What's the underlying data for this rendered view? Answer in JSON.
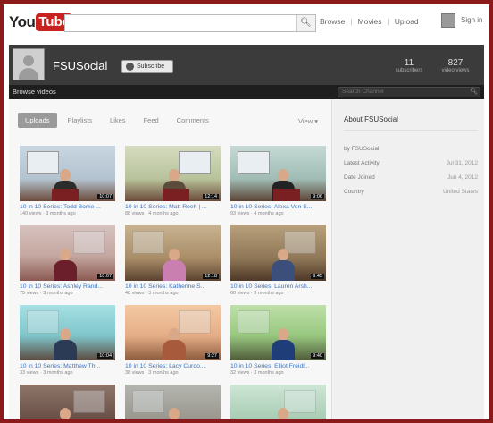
{
  "masthead": {
    "logo_you": "You",
    "logo_tube": "Tube",
    "search_placeholder": "",
    "nav": [
      "Browse",
      "Movies",
      "Upload"
    ],
    "signin": "Sign in"
  },
  "channel": {
    "name": "FSUSocial",
    "subscribe_label": "Subscribe",
    "stats": [
      {
        "value": "11",
        "label": "subscribers"
      },
      {
        "value": "827",
        "label": "video views"
      }
    ]
  },
  "channel_nav": {
    "browse_tab": "Browse videos",
    "search_placeholder": "Search Channel"
  },
  "tabs": [
    "Uploads",
    "Playlists",
    "Likes",
    "Feed",
    "Comments"
  ],
  "active_tab": "Uploads",
  "view_menu": "View ▾",
  "videos": [
    {
      "title": "10 in 10 Series: Todd Borke ...",
      "meta": "140 views · 3 months ago",
      "duration": "10:07",
      "scene": "room-blue"
    },
    {
      "title": "10 in 10 Series: Matt Reeh | ...",
      "meta": "88 views · 4 months ago",
      "duration": "12:14",
      "scene": "room-green"
    },
    {
      "title": "10 in 10 Series: Alexa Von S...",
      "meta": "93 views · 4 months ago",
      "duration": "9:06",
      "scene": "room-teal"
    },
    {
      "title": "10 in 10 Series: Ashley Rand...",
      "meta": "75 views · 3 months ago",
      "duration": "10:07",
      "scene": "room-pink"
    },
    {
      "title": "10 in 10 Series: Katherine S...",
      "meta": "48 views · 3 months ago",
      "duration": "12:18",
      "scene": "room-warm"
    },
    {
      "title": "10 in 10 Series: Lauren Arsh...",
      "meta": "60 views · 3 months ago",
      "duration": "9:45",
      "scene": "room-brown"
    },
    {
      "title": "10 in 10 Series: Matthew Th...",
      "meta": "33 views · 3 months ago",
      "duration": "10:04",
      "scene": "room-cyan"
    },
    {
      "title": "10 in 10 Series: Lacy Curdo...",
      "meta": "38 views · 3 months ago",
      "duration": "9:27",
      "scene": "room-peach"
    },
    {
      "title": "10 in 10 Series: Elliot Freidl...",
      "meta": "32 views · 3 months ago",
      "duration": "9:40",
      "scene": "room-lime"
    },
    {
      "title": "",
      "meta": "",
      "duration": "",
      "scene": "room-dusk"
    },
    {
      "title": "",
      "meta": "",
      "duration": "",
      "scene": "room-gray"
    },
    {
      "title": "",
      "meta": "",
      "duration": "",
      "scene": "room-mint"
    }
  ],
  "sidebar": {
    "title": "About FSUSocial",
    "rows": [
      {
        "key": "by FSUSocial",
        "value": ""
      },
      {
        "key": "Latest Activity",
        "value": "Jul 31, 2012"
      },
      {
        "key": "Date Joined",
        "value": "Jun 4, 2012"
      },
      {
        "key": "Country",
        "value": "United States"
      }
    ]
  },
  "colors": {
    "frame": "#8b1a1a",
    "brand_red": "#c8211e",
    "channel_header": "#3b3b3b",
    "link_blue": "#3a74c4"
  }
}
